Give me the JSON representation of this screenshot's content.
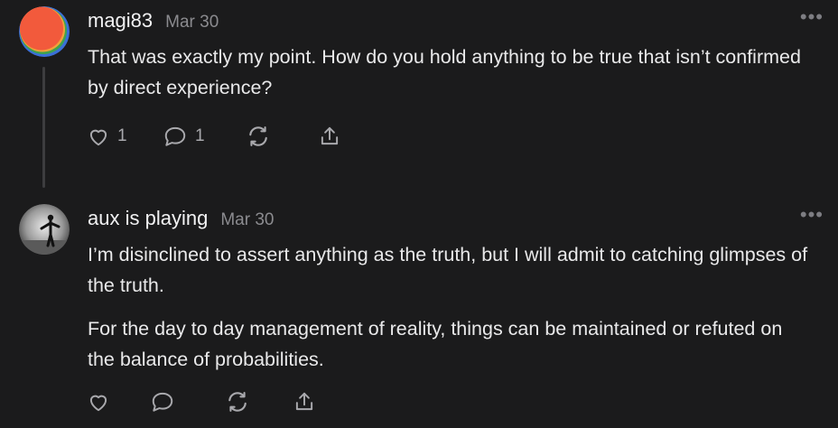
{
  "comments": [
    {
      "author": "magi83",
      "date": "Mar 30",
      "more_label": "•••",
      "paragraphs": [
        "That was exactly my point. How do you hold anything to be true that isn’t confirmed by direct experience?"
      ],
      "like_count": "1",
      "reply_count": "1",
      "avatar_colors": [
        "#f25a3c",
        "#f0a23a",
        "#3fa34d",
        "#3b6fd8"
      ]
    },
    {
      "author": "aux is playing",
      "date": "Mar 30",
      "more_label": "•••",
      "paragraphs": [
        "I’m disinclined to assert anything as the truth, but I will admit to catching glimpses of the truth.",
        "For the day to day management of reality, things can be maintained or refuted on the balance of probabilities."
      ]
    }
  ],
  "colors": {
    "background": "#1b1b1c",
    "text": "#e9e9ea",
    "muted": "#8b8b8f",
    "icon": "#a9a9ad",
    "thread_line": "#3d3d3f"
  },
  "icons": [
    "heart-icon",
    "comment-bubble-icon",
    "restack-icon",
    "share-icon",
    "more-options-icon"
  ]
}
